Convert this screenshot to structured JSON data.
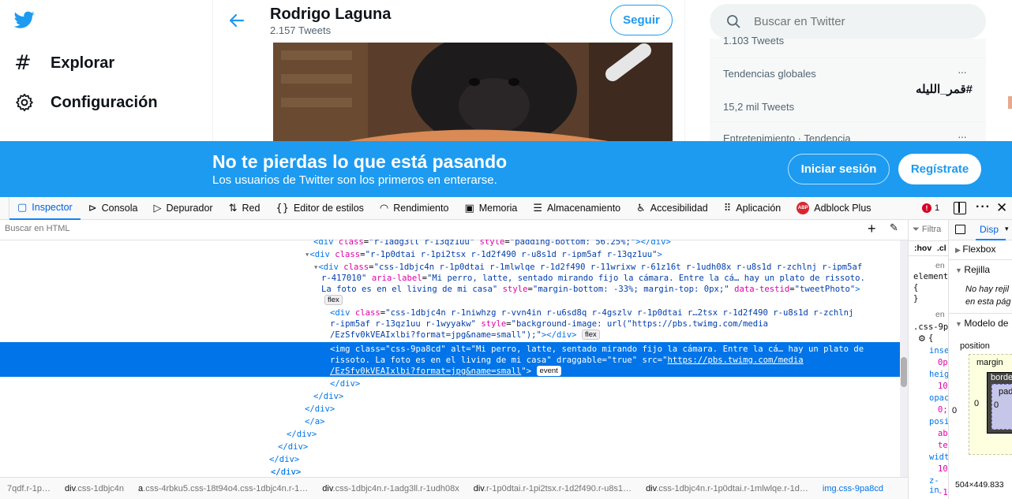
{
  "twitter": {
    "nav": {
      "explore": "Explorar",
      "settings": "Configuración"
    },
    "profile": {
      "name": "Rodrigo Laguna",
      "tweets": "2.157 Tweets",
      "follow": "Seguir"
    },
    "search": {
      "placeholder": "Buscar en Twitter"
    },
    "trends": {
      "top_cut": "1.103 Tweets",
      "item1_category": "Tendencias globales",
      "item1_name": "#قمر_الليله",
      "item1_count": "15,2 mil Tweets",
      "item2_category": "Entretenimiento · Tendencia",
      "more": "···"
    },
    "banner": {
      "title": "No te pierdas lo que está pasando",
      "subtitle": "Los usuarios de Twitter son los primeros en enterarse.",
      "login": "Iniciar sesión",
      "signup": "Regístrate"
    }
  },
  "devtools": {
    "tabs": [
      "Inspector",
      "Consola",
      "Depurador",
      "Red",
      "Editor de estilos",
      "Rendimiento",
      "Memoria",
      "Almacenamiento",
      "Accesibilidad",
      "Aplicación",
      "Adblock Plus"
    ],
    "error_count": "1",
    "search_placeholder": "Buscar en HTML",
    "badges": {
      "flex": "flex",
      "event": "event"
    },
    "code": {
      "l0_cls": "r-1adg3ll r-13qz1uu",
      "l0_style": "padding-bottom: 56.25%;",
      "l1_cls": "r-1p0dtai r-1pi2tsx r-1d2f490 r-u8s1d r-ipm5af r-13qz1uu",
      "l2_cls_a": "css-1dbjc4n r-1p0dtai r-1mlwlqe r-1d2f490 r-11wrixw r-61z16t r-1udh08x r-u8s1d r-zchlnj r-ipm5af",
      "l2_cls_b": "r-417010",
      "l2_aria_a": "Mi perro, latte, sentado mirando fijo la cámara. Entre la cá… hay un plato de rissoto.",
      "l2_aria_b": "La foto es en el living de mi casa",
      "l2_style": "margin-bottom: -33%; margin-top: 0px;",
      "l2_testid": "tweetPhoto",
      "l3_cls_a": "css-1dbjc4n r-1niwhzg r-vvn4in r-u6sd8q r-4gszlv r-1p0dtai r…2tsx r-1d2f490 r-u8s1d r-zchlnj",
      "l3_cls_b": "r-ipm5af r-13qz1uu r-1wyyakw",
      "l3_style_a": "background-image: url(\"https://pbs.twimg.com/media",
      "l3_style_b": "/EzSfv0kVEAIxlbi?format=jpg&name=small\");",
      "img_cls": "css-9pa8cd",
      "img_alt_a": "Mi perro, latte, sentado mirando fijo la cámara. Entre la cá… hay un plato de",
      "img_alt_b": "rissoto. La foto es en el living de mi casa",
      "img_draggable": "true",
      "img_src_a": "https://pbs.twimg.com/media",
      "img_src_b": "/EzSfv0kVEAIxlbi?format=jpg&name=small",
      "close_div": "</div>",
      "close_a": "</a>"
    },
    "breadcrumbs": [
      {
        "tag": "",
        "cls": "7qdf.r-1p…"
      },
      {
        "tag": "div",
        "cls": ".css-1dbjc4n"
      },
      {
        "tag": "a",
        "cls": ".css-4rbku5.css-18t94o4.css-1dbjc4n.r-1…"
      },
      {
        "tag": "div",
        "cls": ".css-1dbjc4n.r-1adg3ll.r-1udh08x"
      },
      {
        "tag": "div",
        "cls": ".r-1p0dtai.r-1pi2tsx.r-1d2f490.r-u8s1…"
      },
      {
        "tag": "div",
        "cls": ".css-1dbjc4n.r-1p0dtai.r-1mlwlqe.r-1d…"
      },
      {
        "tag": "img",
        "cls": ".css-9pa8cd"
      }
    ],
    "rules": {
      "filter": "Filtra",
      "hov": ":hov",
      "cls": ".cl",
      "en": "en",
      "element": "element",
      "brace_open": "{",
      "brace_close": "}",
      "css9": ".css-9p",
      "props": [
        "inse",
        "0p",
        "heig",
        "10",
        "opac",
        "0;",
        "posi",
        "ab",
        "te",
        "widt",
        "10",
        "z-in",
        "-1"
      ]
    },
    "layout": {
      "tab": "Disp",
      "flexbox": "Flexbox",
      "grid": "Rejilla",
      "no_grid_a": "No hay rejil",
      "no_grid_b": "en esta pág",
      "box_model": "Modelo de",
      "position": "position",
      "margin": "margin",
      "border": "borde",
      "padding": "pad",
      "zero": "0",
      "dimensions": "504×449.833"
    }
  }
}
